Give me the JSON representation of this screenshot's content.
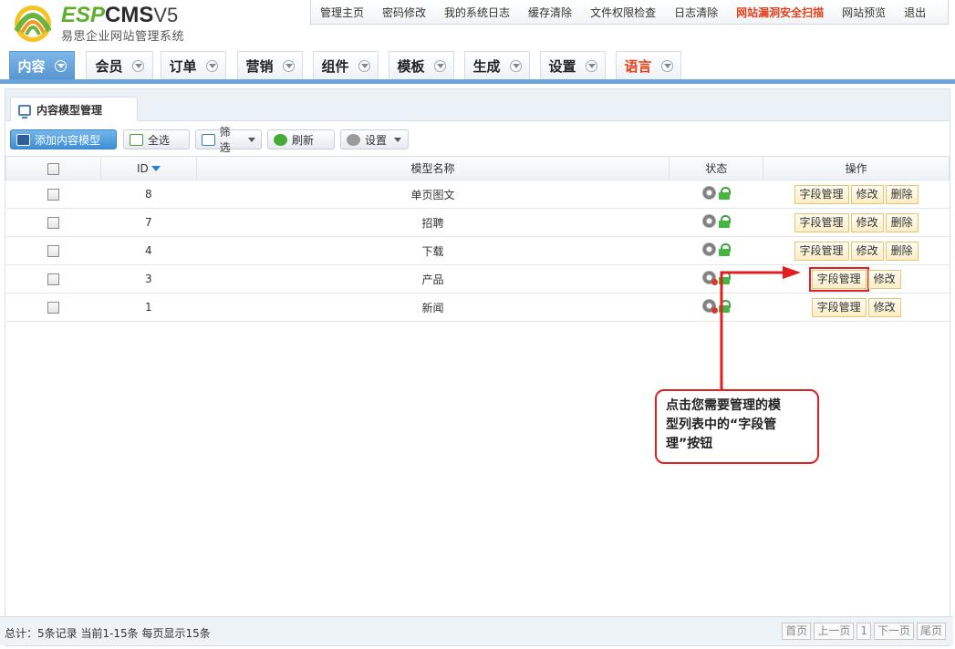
{
  "brand": {
    "name_a": "ESP",
    "name_b": "CMS",
    "version": "V5",
    "subtitle": "易思企业网站管理系统"
  },
  "topnav": [
    {
      "label": "管理主页"
    },
    {
      "label": "密码修改"
    },
    {
      "label": "我的系统日志"
    },
    {
      "label": "缓存清除"
    },
    {
      "label": "文件权限检查"
    },
    {
      "label": "日志清除"
    },
    {
      "label": "网站漏洞安全扫描"
    },
    {
      "label": "网站预览"
    },
    {
      "label": "退出"
    }
  ],
  "mainnav": [
    {
      "label": "内容"
    },
    {
      "label": "会员"
    },
    {
      "label": "订单"
    },
    {
      "label": "营销"
    },
    {
      "label": "组件"
    },
    {
      "label": "模板"
    },
    {
      "label": "生成"
    },
    {
      "label": "设置"
    },
    {
      "label": "语言"
    }
  ],
  "panel": {
    "title": "内容模型管理"
  },
  "toolbar": {
    "add": "添加内容模型",
    "select_all": "全选",
    "filter": "筛选",
    "refresh": "刷新",
    "settings": "设置"
  },
  "table": {
    "headers": {
      "id": "ID",
      "name": "模型名称",
      "status": "状态",
      "actions": "操作"
    },
    "rows": [
      {
        "id": "8",
        "name": "单页图文",
        "fields": "字段管理",
        "edit": "修改",
        "delete": "删除"
      },
      {
        "id": "7",
        "name": "招聘",
        "fields": "字段管理",
        "edit": "修改",
        "delete": "删除"
      },
      {
        "id": "4",
        "name": "下载",
        "fields": "字段管理",
        "edit": "修改",
        "delete": "删除"
      },
      {
        "id": "3",
        "name": "产品",
        "fields": "字段管理",
        "edit": "修改"
      },
      {
        "id": "1",
        "name": "新闻",
        "fields": "字段管理",
        "edit": "修改"
      }
    ]
  },
  "callout": {
    "line1": "点击您需要管理的模",
    "line2": "型列表中的“字段管",
    "line3": "理”按钮"
  },
  "footer": {
    "summary": "总计：5条记录 当前1-15条 每页显示15条",
    "first": "首页",
    "prev": "上一页",
    "page": "1",
    "next": "下一页",
    "last": "尾页"
  },
  "colors": {
    "accent": "#5a98d1",
    "danger": "#e0401a",
    "annotation": "#e02020"
  }
}
